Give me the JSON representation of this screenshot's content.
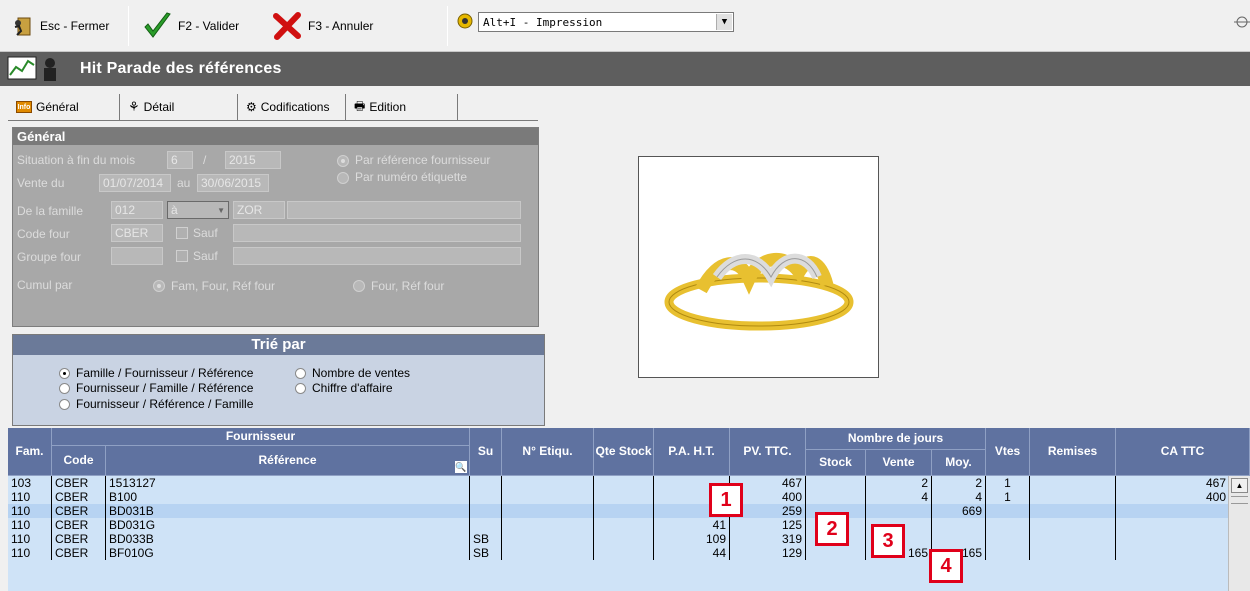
{
  "toolbar": {
    "close_label": "Esc - Fermer",
    "validate_label": "F2 - Valider",
    "cancel_label": "F3 - Annuler",
    "print_combo_value": "Alt+I  - Impression"
  },
  "window": {
    "title": "Hit Parade des références"
  },
  "tabs": [
    {
      "label": "Général",
      "icon": "info-icon"
    },
    {
      "label": "Détail",
      "icon": "detail-icon"
    },
    {
      "label": "Codifications",
      "icon": "codifications-icon"
    },
    {
      "label": "Edition",
      "icon": "printer-icon"
    }
  ],
  "general": {
    "header": "Général",
    "situation_label": "Situation à fin du mois",
    "situation_month": "6",
    "situation_sep": "/",
    "situation_year": "2015",
    "vente_label": "Vente du",
    "vente_from": "01/07/2014",
    "vente_au": "au",
    "vente_to": "30/06/2015",
    "famille_label": "De la famille",
    "famille_from": "012",
    "famille_op": "à",
    "famille_to": "ZOR",
    "code_four_label": "Code four",
    "code_four_value": "CBER",
    "sauf_label": "Sauf",
    "groupe_four_label": "Groupe four",
    "groupe_sauf_label": "Sauf",
    "cumul_label": "Cumul par",
    "cumul_opt1": "Fam, Four, Réf four",
    "cumul_opt2": "Four, Réf four",
    "radio_ref_fournisseur": "Par référence fournisseur",
    "radio_num_etiquette": "Par numéro étiquette"
  },
  "sort": {
    "header": "Trié par",
    "opt1": "Famille / Fournisseur / Référence",
    "opt2": "Fournisseur / Famille / Référence",
    "opt3": "Fournisseur / Référence / Famille",
    "opt4": "Nombre de ventes",
    "opt5": "Chiffre d'affaire"
  },
  "grid": {
    "headers": {
      "fam": "Fam.",
      "fournisseur": "Fournisseur",
      "code": "Code",
      "reference": "Référence",
      "su": "Su",
      "etiq": "N° Etiqu.",
      "qte_stock": "Qte Stock",
      "pa_ht": "P.A. H.T.",
      "pv_ttc": "PV. TTC.",
      "nb_jours": "Nombre de jours",
      "stock": "Stock",
      "vente": "Vente",
      "moy": "Moy.",
      "vtes": "Vtes",
      "remises": "Remises",
      "ca_ttc": "CA TTC"
    },
    "rows": [
      {
        "fam": "103",
        "code": "CBER",
        "ref": "1513127",
        "su": "",
        "pa": "",
        "pv": "467",
        "stock": "",
        "vente": "2",
        "moy": "2",
        "vtes": "1",
        "ca": "467"
      },
      {
        "fam": "110",
        "code": "CBER",
        "ref": "B100",
        "su": "",
        "pa": "",
        "pv": "400",
        "stock": "",
        "vente": "4",
        "moy": "4",
        "vtes": "1",
        "ca": "400"
      },
      {
        "fam": "110",
        "code": "CBER",
        "ref": "BD031B",
        "su": "",
        "pa": "",
        "pv": "259",
        "stock": "",
        "vente": "",
        "moy": "669",
        "vtes": "",
        "ca": ""
      },
      {
        "fam": "110",
        "code": "CBER",
        "ref": "BD031G",
        "su": "",
        "pa": "41",
        "pv": "125",
        "stock": "",
        "vente": "",
        "moy": "",
        "vtes": "",
        "ca": ""
      },
      {
        "fam": "110",
        "code": "CBER",
        "ref": "BD033B",
        "su": "SB",
        "pa": "109",
        "pv": "319",
        "stock": "",
        "vente": "",
        "moy": "",
        "vtes": "",
        "ca": ""
      },
      {
        "fam": "110",
        "code": "CBER",
        "ref": "BF010G",
        "su": "SB",
        "pa": "44",
        "pv": "129",
        "stock": "",
        "vente": "165",
        "moy": "165",
        "vtes": "",
        "ca": ""
      }
    ]
  },
  "markers": [
    "1",
    "2",
    "3",
    "4"
  ],
  "colors": {
    "header_blue": "#5f72a0",
    "row_blue": "#cfe3f7",
    "selected_row": "#b7d3f2",
    "marker_red": "#e0001a"
  }
}
